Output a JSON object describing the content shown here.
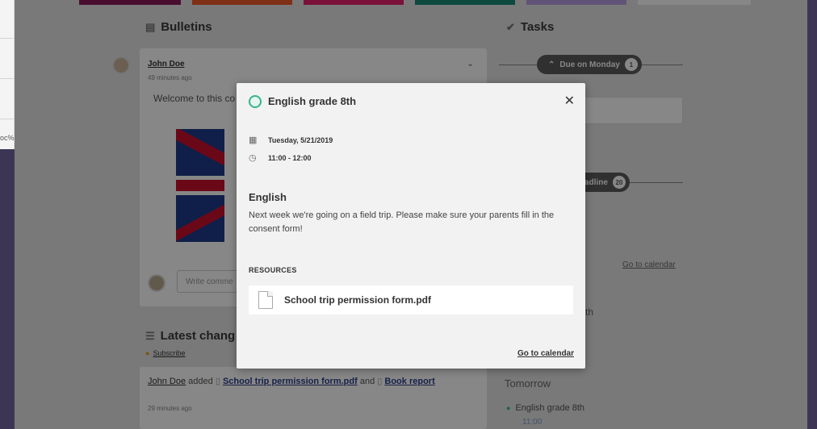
{
  "left_url_fragment": "oc%",
  "bulletins": {
    "title": "Bulletins",
    "post": {
      "author": "John Doe",
      "time_ago": "49 minutes ago",
      "text_visible": "Welcome to this co",
      "comment_placeholder": "Write comme"
    }
  },
  "latest_changes": {
    "title": "Latest chang",
    "subscribe": "Subscribe",
    "item": {
      "author": "John Doe",
      "verb": "added",
      "file1": "School trip permission form.pdf",
      "conj": "and",
      "file2": "Book report",
      "time_ago": "29 minutes ago"
    }
  },
  "tasks": {
    "title": "Tasks",
    "due_pill": {
      "label": "Due on Monday",
      "count": "1"
    },
    "deadline_pill": {
      "label_visible": "adline",
      "count": "20"
    },
    "go_to_calendar": "Go to calendar",
    "partial_item": "th",
    "tomorrow_heading": "Tomorrow",
    "tomorrow_item": {
      "title": "English grade 8th",
      "time": "11:00"
    }
  },
  "modal": {
    "title": "English grade 8th",
    "date": "Tuesday, 5/21/2019",
    "time": "11:00 - 12:00",
    "subject": "English",
    "description": "Next week we're going on a field trip. Please make sure your parents fill in the consent form!",
    "resources_label": "RESOURCES",
    "file": "School trip permission form.pdf",
    "go_to_calendar": "Go to calendar",
    "icons": {
      "status": "circle-icon",
      "close": "close-icon",
      "date": "calendar-icon",
      "time": "clock-icon",
      "file": "document-icon"
    }
  },
  "colors": {
    "accent_green": "#37b58a",
    "tile_colors": [
      "#8a1a5a",
      "#f05a28",
      "#e4206e",
      "#1a8a78",
      "#b79ee0"
    ]
  }
}
